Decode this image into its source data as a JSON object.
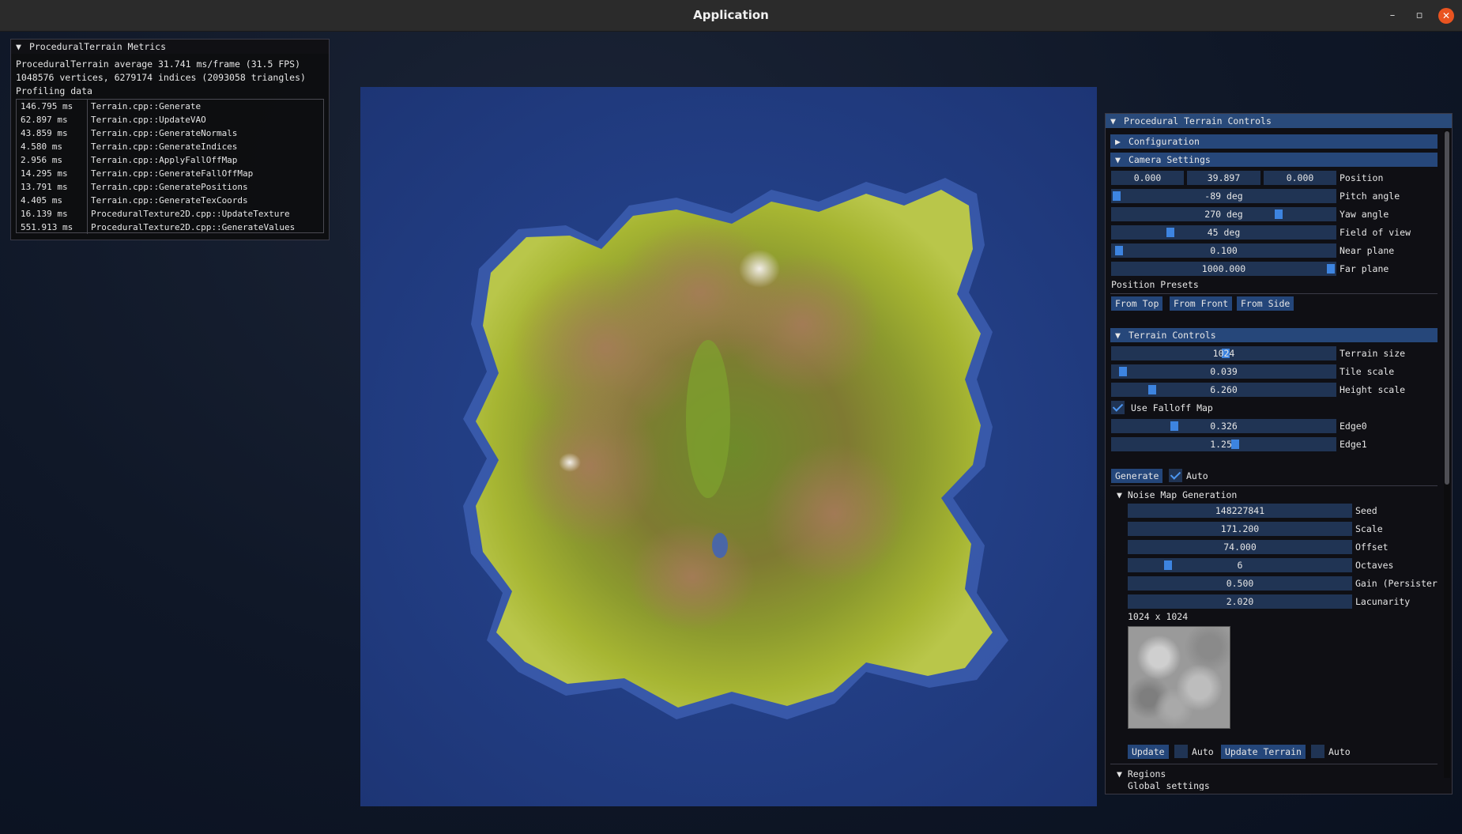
{
  "window": {
    "title": "Application",
    "minimize": "–",
    "maximize": "▫",
    "close": "✕"
  },
  "metrics": {
    "title": "ProceduralTerrain Metrics",
    "fps_line": "ProceduralTerrain average 31.741 ms/frame (31.5 FPS)",
    "mesh_line": "1048576 vertices, 6279174 indices (2093058 triangles)",
    "profiling_label": "Profiling data",
    "profiling": [
      {
        "time": "146.795 ms",
        "name": "Terrain.cpp::Generate"
      },
      {
        "time": "62.897 ms",
        "name": "Terrain.cpp::UpdateVAO"
      },
      {
        "time": "43.859 ms",
        "name": "Terrain.cpp::GenerateNormals"
      },
      {
        "time": "4.580 ms",
        "name": "Terrain.cpp::GenerateIndices"
      },
      {
        "time": "2.956 ms",
        "name": "Terrain.cpp::ApplyFallOffMap"
      },
      {
        "time": "14.295 ms",
        "name": "Terrain.cpp::GenerateFallOffMap"
      },
      {
        "time": "13.791 ms",
        "name": "Terrain.cpp::GeneratePositions"
      },
      {
        "time": "4.405 ms",
        "name": "Terrain.cpp::GenerateTexCoords"
      },
      {
        "time": "16.139 ms",
        "name": "ProceduralTexture2D.cpp::UpdateTexture"
      },
      {
        "time": "551.913 ms",
        "name": "ProceduralTexture2D.cpp::GenerateValues"
      }
    ]
  },
  "controls": {
    "title": "Procedural Terrain Controls",
    "configuration": "Configuration",
    "camera_settings": "Camera Settings",
    "position": {
      "x": "0.000",
      "y": "39.897",
      "z": "0.000",
      "label": "Position"
    },
    "pitch": {
      "value": "-89 deg",
      "label": "Pitch angle",
      "fraction": 0.01
    },
    "yaw": {
      "value": "270 deg",
      "label": "Yaw angle",
      "fraction": 0.75
    },
    "fov": {
      "value": "45 deg",
      "label": "Field of view",
      "fraction": 0.25
    },
    "near": {
      "value": "0.100",
      "label": "Near plane",
      "fraction": 0.02
    },
    "far": {
      "value": "1000.000",
      "label": "Far plane",
      "fraction": 1.0
    },
    "position_presets": "Position Presets",
    "presets": [
      "From Top",
      "From Front",
      "From Side"
    ],
    "terrain_controls": "Terrain Controls",
    "terrain_size": {
      "value": "1024",
      "label": "Terrain size",
      "fraction": 0.5
    },
    "tile_scale": {
      "value": "0.039",
      "label": "Tile scale",
      "fraction": 0.04
    },
    "height_scale": {
      "value": "6.260",
      "label": "Height scale",
      "fraction": 0.17
    },
    "use_falloff": "Use Falloff Map",
    "edge0": {
      "value": "0.326",
      "label": "Edge0",
      "fraction": 0.27
    },
    "edge1": {
      "value": "1.250",
      "label": "Edge1",
      "fraction": 0.54
    },
    "generate": "Generate",
    "auto": "Auto",
    "noise_map": "Noise Map Generation",
    "seed": {
      "value": "148227841",
      "label": "Seed"
    },
    "scale": {
      "value": "171.200",
      "label": "Scale"
    },
    "offset": {
      "value": "74.000",
      "label": "Offset"
    },
    "octaves": {
      "value": "6",
      "label": "Octaves",
      "fraction": 0.17
    },
    "gain": {
      "value": "0.500",
      "label": "Gain (Persister"
    },
    "lacunarity": {
      "value": "2.020",
      "label": "Lacunarity"
    },
    "texture_size": "1024 x 1024",
    "update": "Update",
    "update_terrain": "Update Terrain",
    "regions": "Regions",
    "global_settings": "Global settings"
  }
}
